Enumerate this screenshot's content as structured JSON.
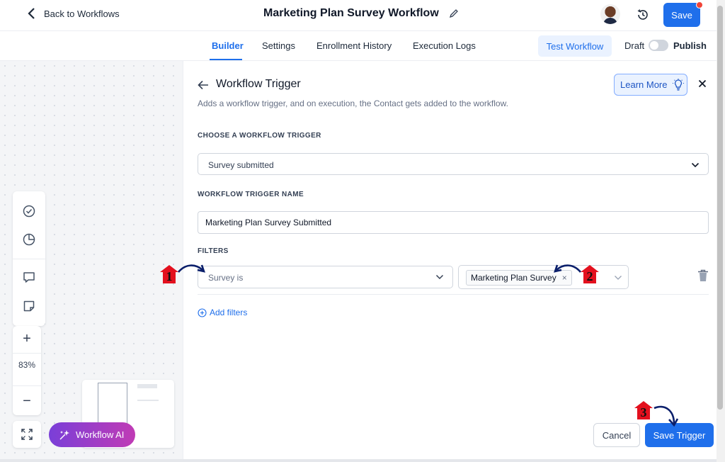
{
  "header": {
    "back_label": "Back to Workflows",
    "workflow_title": "Marketing Plan Survey Workflow",
    "save_label": "Save"
  },
  "tabs": [
    {
      "label": "Builder",
      "active": true
    },
    {
      "label": "Settings",
      "active": false
    },
    {
      "label": "Enrollment History",
      "active": false
    },
    {
      "label": "Execution Logs",
      "active": false
    }
  ],
  "toolbar": {
    "test_workflow_label": "Test Workflow",
    "draft_label": "Draft",
    "publish_label": "Publish",
    "publish_toggle_on": false
  },
  "canvas": {
    "zoom_level": "83%",
    "workflow_ai_label": "Workflow AI"
  },
  "panel": {
    "title": "Workflow Trigger",
    "subtitle": "Adds a workflow trigger, and on execution, the Contact gets added to the workflow.",
    "learn_more_label": "Learn More",
    "trigger_label": "CHOOSE A WORKFLOW TRIGGER",
    "trigger_value": "Survey submitted",
    "name_label": "WORKFLOW TRIGGER NAME",
    "name_value": "Marketing Plan Survey Submitted",
    "filters_label": "FILTERS",
    "filter_condition_placeholder": "Survey is",
    "filter_chip": "Marketing Plan Survey",
    "chip_remove": "×",
    "add_filters_label": "Add filters",
    "cancel_label": "Cancel",
    "save_trigger_label": "Save Trigger"
  },
  "annotations": [
    {
      "number": "1"
    },
    {
      "number": "2"
    },
    {
      "number": "3"
    }
  ],
  "colors": {
    "accent": "#1f6feb",
    "badge_red": "#e3101e",
    "arrow_navy": "#0b1f6b",
    "ai_gradient_start": "#7a3fd8",
    "ai_gradient_end": "#c03bb5"
  },
  "icons": [
    "chevron-left-icon",
    "pencil-icon",
    "history-icon",
    "check-circle-icon",
    "pie-chart-icon",
    "comment-icon",
    "sticky-note-icon",
    "expand-icon",
    "sparkle-icon",
    "arrow-left-icon",
    "lightbulb-icon",
    "close-icon",
    "chevron-down-icon",
    "trash-icon",
    "plus-circle-icon"
  ]
}
